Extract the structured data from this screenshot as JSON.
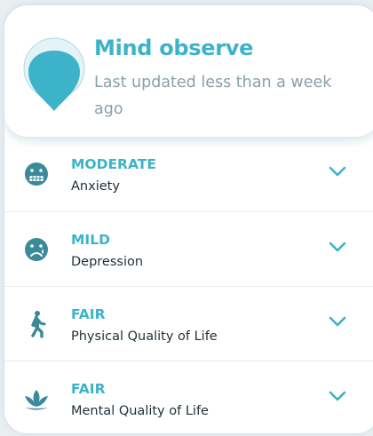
{
  "header": {
    "title": "Mind observe",
    "subtitle": "Last updated less than a week ago"
  },
  "rows": [
    {
      "level": "MODERATE",
      "label": "Anxiety",
      "icon": "grimace-face-icon"
    },
    {
      "level": "MILD",
      "label": "Depression",
      "icon": "sad-face-icon"
    },
    {
      "level": "FAIR",
      "label": "Physical Quality of Life",
      "icon": "walking-person-icon"
    },
    {
      "level": "FAIR",
      "label": "Mental Quality of Life",
      "icon": "lotus-icon"
    }
  ],
  "colors": {
    "accent": "#3db3c9",
    "text": "#1f2f37",
    "muted": "#8aa0ab"
  }
}
